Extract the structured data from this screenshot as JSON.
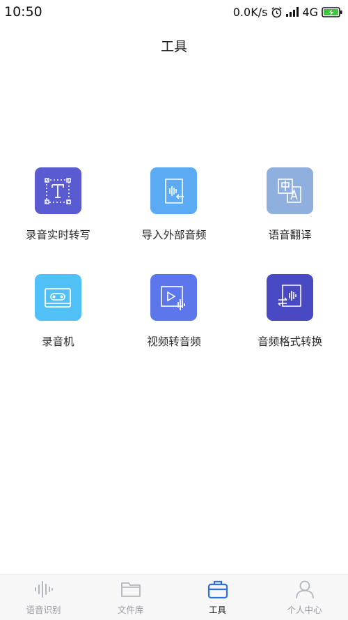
{
  "status_bar": {
    "time": "10:50",
    "speed": "0.0K/s",
    "network": "4G",
    "alarm_icon": "alarm-clock-icon",
    "signal_icon": "signal-bars-icon",
    "battery_icon": "battery-charging-icon"
  },
  "header": {
    "title": "工具"
  },
  "tools": [
    {
      "label": "录音实时转写",
      "icon": "text-transcribe-icon",
      "color": "#5b5bd1"
    },
    {
      "label": "导入外部音频",
      "icon": "import-audio-icon",
      "color": "#5aaaf4"
    },
    {
      "label": "语音翻译",
      "icon": "translate-icon",
      "color": "#8fb0de"
    },
    {
      "label": "录音机",
      "icon": "cassette-icon",
      "color": "#50c0f6"
    },
    {
      "label": "视频转音频",
      "icon": "video-to-audio-icon",
      "color": "#5c76ec"
    },
    {
      "label": "音频格式转换",
      "icon": "audio-convert-icon",
      "color": "#4a49c4"
    }
  ],
  "bottom_nav": [
    {
      "label": "语音识别",
      "icon": "waveform-icon",
      "active": false
    },
    {
      "label": "文件库",
      "icon": "folder-icon",
      "active": false
    },
    {
      "label": "工具",
      "icon": "toolbox-icon",
      "active": true
    },
    {
      "label": "个人中心",
      "icon": "person-icon",
      "active": false
    }
  ],
  "colors": {
    "active_nav": "#2f6fe0",
    "inactive_nav": "#b4b6be"
  }
}
